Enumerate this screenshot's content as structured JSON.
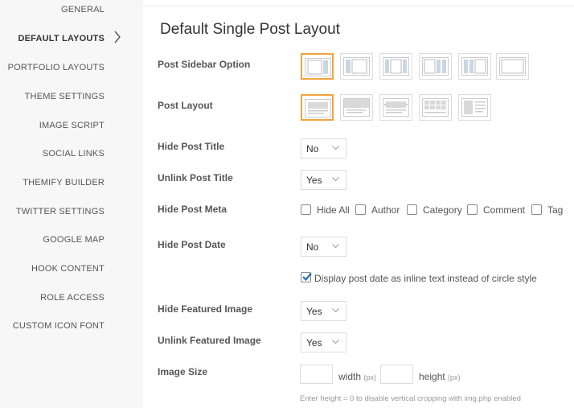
{
  "sidebar": {
    "items": [
      {
        "label": "GENERAL",
        "active": false
      },
      {
        "label": "DEFAULT LAYOUTS",
        "active": true
      },
      {
        "label": "PORTFOLIO LAYOUTS",
        "active": false
      },
      {
        "label": "THEME SETTINGS",
        "active": false
      },
      {
        "label": "IMAGE SCRIPT",
        "active": false
      },
      {
        "label": "SOCIAL LINKS",
        "active": false
      },
      {
        "label": "THEMIFY BUILDER",
        "active": false
      },
      {
        "label": "TWITTER SETTINGS",
        "active": false
      },
      {
        "label": "GOOGLE MAP",
        "active": false
      },
      {
        "label": "HOOK CONTENT",
        "active": false
      },
      {
        "label": "ROLE ACCESS",
        "active": false
      },
      {
        "label": "CUSTOM ICON FONT",
        "active": false
      }
    ],
    "active_indicator_icon": "chevron-right-icon"
  },
  "main": {
    "title": "Default Single Post Layout",
    "post_sidebar_option": {
      "label": "Post Sidebar Option",
      "options": [
        "sidebar-right",
        "sidebar-left",
        "sidebar-both-sides",
        "sidebar-both-right",
        "sidebar-both-left",
        "no-sidebar"
      ],
      "selected": "sidebar-right"
    },
    "post_layout": {
      "label": "Post Layout",
      "options": [
        "classic",
        "fullwidth-image",
        "split-image",
        "gallery",
        "split"
      ],
      "selected": "classic"
    },
    "hide_post_title": {
      "label": "Hide Post Title",
      "value": "No"
    },
    "unlink_post_title": {
      "label": "Unlink Post Title",
      "value": "Yes"
    },
    "hide_post_meta": {
      "label": "Hide Post Meta",
      "options": [
        {
          "label": "Hide All",
          "checked": false
        },
        {
          "label": "Author",
          "checked": false
        },
        {
          "label": "Category",
          "checked": false
        },
        {
          "label": "Comment",
          "checked": false
        },
        {
          "label": "Tag",
          "checked": false
        }
      ]
    },
    "hide_post_date": {
      "label": "Hide Post Date",
      "value": "No"
    },
    "inline_date": {
      "label": "Display post date as inline text instead of circle style",
      "checked": true
    },
    "hide_featured_image": {
      "label": "Hide Featured Image",
      "value": "Yes"
    },
    "unlink_featured_image": {
      "label": "Unlink Featured Image",
      "value": "Yes"
    },
    "image_size": {
      "label": "Image Size",
      "width_label": "width",
      "height_label": "height",
      "unit": "(px)",
      "width_value": "",
      "height_value": "",
      "help": "Enter height = 0 to disable vertical cropping with img.php enabled"
    }
  },
  "colors": {
    "accent": "#f3a33d",
    "check": "#1f6fb2",
    "border": "#dddddd",
    "sidebar_bg": "#f7f7f7"
  }
}
